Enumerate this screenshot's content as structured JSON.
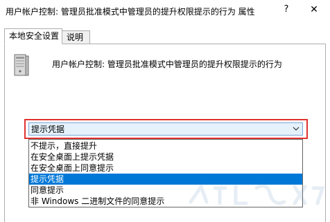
{
  "window": {
    "title": "用户帐户控制: 管理员批准模式中管理员的提升权限提示的行为 属性",
    "help_glyph": "?",
    "close_glyph": "✕"
  },
  "tabs": [
    {
      "label": "本地安全设置",
      "active": true
    },
    {
      "label": "说明",
      "active": false
    }
  ],
  "policy": {
    "icon": "server-computer-icon",
    "name": "用户帐户控制: 管理员批准模式中管理员的提升权限提示的行为"
  },
  "combo": {
    "selected_value": "提示凭据",
    "arrow_icon": "chevron-down-icon",
    "highlight_color": "#e0322f"
  },
  "dropdown": {
    "options": [
      "不提示，直接提升",
      "在安全桌面上提示凭据",
      "在安全桌面上同意提示",
      "提示凭据",
      "同意提示",
      "非 Windows 二进制文件的同意提示"
    ],
    "selected_index": 3,
    "selection_color": "#0078d7"
  }
}
